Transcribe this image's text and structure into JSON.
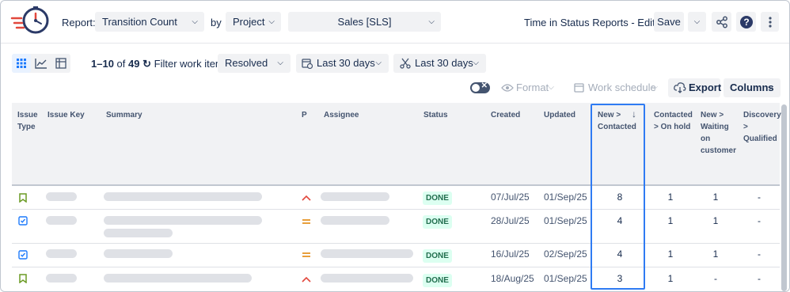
{
  "header": {
    "report_label": "Report:",
    "report_value": "Transition Count",
    "by_label": "by",
    "group_value": "Project",
    "project_value": "Sales [SLS]",
    "title": "Time in Status Reports - Edited",
    "save_label": "Save"
  },
  "toolbar": {
    "range": "1–10",
    "of_label": "of",
    "total": "49",
    "filter_label": "Filter work items:",
    "filter_value": "Resolved",
    "date_filter_1": "Last 30 days",
    "date_filter_2": "Last 30 days",
    "format_label": "Format",
    "schedule_label": "Work schedule",
    "export_label": "Export",
    "columns_label": "Columns"
  },
  "table": {
    "headers": {
      "issue_type": "Issue Type",
      "issue_key": "Issue Key",
      "summary": "Summary",
      "priority": "P",
      "assignee": "Assignee",
      "status": "Status",
      "created": "Created",
      "updated": "Updated",
      "new_contacted": "New > Contacted",
      "contacted_onhold": "Contacted > On hold",
      "new_waiting": "New > Waiting on customer",
      "discovery_qualified": "Discovery > Qualified"
    },
    "rows": [
      {
        "type": "story",
        "priority": "high",
        "status": "DONE",
        "created": "07/Jul/25",
        "updated": "01/Sep/25",
        "new_contacted": "8",
        "contacted_onhold": "1",
        "new_waiting": "1",
        "discovery_qualified": "-"
      },
      {
        "type": "task",
        "priority": "medium",
        "status": "DONE",
        "created": "28/Jul/25",
        "updated": "01/Sep/25",
        "new_contacted": "4",
        "contacted_onhold": "1",
        "new_waiting": "1",
        "discovery_qualified": "-"
      },
      {
        "type": "task",
        "priority": "medium",
        "status": "DONE",
        "created": "16/Jul/25",
        "updated": "02/Sep/25",
        "new_contacted": "4",
        "contacted_onhold": "1",
        "new_waiting": "1",
        "discovery_qualified": "-"
      },
      {
        "type": "story",
        "priority": "high",
        "status": "DONE",
        "created": "18/Aug/25",
        "updated": "01/Sep/25",
        "new_contacted": "3",
        "contacted_onhold": "1",
        "new_waiting": "-",
        "discovery_qualified": "-"
      }
    ]
  },
  "icons": {
    "logo": "stopwatch-logo-icon",
    "share": "share-icon",
    "help": "help-icon",
    "more": "more-vertical-icon",
    "sort": "arrow-down-icon"
  },
  "colors": {
    "accent": "#2f7bf3",
    "done_bg": "#dcfff1",
    "done_text": "#216e4e",
    "priority_high": "#e2483d",
    "priority_medium": "#e2870b",
    "story": "#6a9a23",
    "task": "#1d7afc"
  }
}
